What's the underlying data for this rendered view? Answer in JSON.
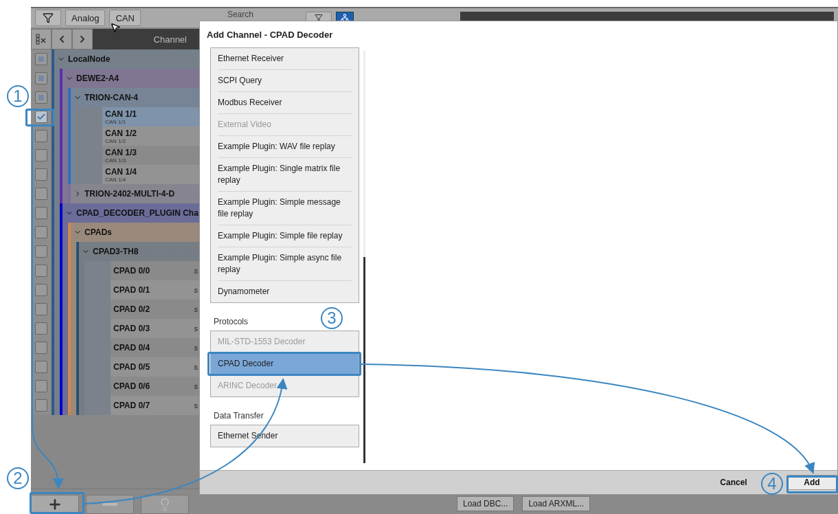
{
  "toolbar": {
    "filters": [
      "Analog",
      "CAN"
    ],
    "search_label": "Search"
  },
  "channel_header": "Channel",
  "tree": [
    {
      "name": "LocalNode",
      "color": "#2d5a8a",
      "expanded": true,
      "checked": false,
      "indeterminate": true,
      "children": [
        {
          "name": "DEWE2-A4",
          "color": "#5a2fb0",
          "expanded": true,
          "checked": false,
          "indeterminate": true,
          "children": [
            {
              "name": "TRION-CAN-4",
              "color": "#2f6fc0",
              "expanded": true,
              "checked": false,
              "indeterminate": true,
              "children": [
                {
                  "name": "CAN 1/1",
                  "sub": "CAN 1/1",
                  "checked": true,
                  "selected": true
                },
                {
                  "name": "CAN 1/2",
                  "sub": "CAN 1/2",
                  "checked": false,
                  "selected": false
                },
                {
                  "name": "CAN 1/3",
                  "sub": "CAN 1/3",
                  "checked": false,
                  "selected": false
                },
                {
                  "name": "CAN 1/4",
                  "sub": "CAN 1/4",
                  "checked": false,
                  "selected": false
                }
              ]
            },
            {
              "name": "TRION-2402-MULTI-4-D",
              "color": "#7a6fa0",
              "expanded": false,
              "checked": false,
              "indeterminate": false
            }
          ]
        },
        {
          "name": "CPAD_DECODER_PLUGIN Cha",
          "color": "#0000d0",
          "expanded": true,
          "checked": false,
          "indeterminate": false,
          "children": [
            {
              "name": "CPADs",
              "color": "#d0884a",
              "expanded": true,
              "checked": false,
              "indeterminate": false,
              "children": [
                {
                  "name": "CPAD3-TH8",
                  "color": "#2d4f70",
                  "expanded": true,
                  "checked": false,
                  "indeterminate": false,
                  "children": [
                    {
                      "name": "CPAD 0/0",
                      "column_2": "s",
                      "checked": false,
                      "selected": false
                    },
                    {
                      "name": "CPAD 0/1",
                      "column_2": "s",
                      "checked": false,
                      "selected": false
                    },
                    {
                      "name": "CPAD 0/2",
                      "column_2": "s",
                      "checked": false,
                      "selected": false
                    },
                    {
                      "name": "CPAD 0/3",
                      "column_2": "s",
                      "checked": false,
                      "selected": false
                    },
                    {
                      "name": "CPAD 0/4",
                      "column_2": "s",
                      "checked": false,
                      "selected": false
                    },
                    {
                      "name": "CPAD 0/5",
                      "column_2": "s",
                      "checked": false,
                      "selected": false
                    },
                    {
                      "name": "CPAD 0/6",
                      "column_2": "s",
                      "checked": false,
                      "selected": false
                    },
                    {
                      "name": "CPAD 0/7",
                      "column_2": "s",
                      "checked": false,
                      "selected": false
                    }
                  ]
                }
              ]
            }
          ]
        }
      ]
    }
  ],
  "bottom_buttons": [
    {
      "kind": "add",
      "disabled": false
    },
    {
      "kind": "remove",
      "disabled": true
    },
    {
      "kind": "wizard",
      "disabled": true
    }
  ],
  "load_buttons": [
    "Load DBC...",
    "Load ARXML..."
  ],
  "dialog": {
    "title": "Add Channel - CPAD Decoder",
    "sections": [
      {
        "items": [
          {
            "label": "Ethernet Receiver",
            "disabled": false,
            "selected": false
          },
          {
            "label": "SCPI Query",
            "disabled": false,
            "selected": false
          },
          {
            "label": "Modbus Receiver",
            "disabled": false,
            "selected": false
          },
          {
            "label": "External Video",
            "disabled": true,
            "selected": false
          },
          {
            "label": "Example Plugin: WAV file replay",
            "disabled": false,
            "selected": false
          },
          {
            "label": "Example Plugin: Single matrix file replay",
            "disabled": false,
            "selected": false
          },
          {
            "label": "Example Plugin: Simple message file replay",
            "disabled": false,
            "selected": false
          },
          {
            "label": "Example Plugin: Simple file replay",
            "disabled": false,
            "selected": false
          },
          {
            "label": "Example Plugin: Simple async file replay",
            "disabled": false,
            "selected": false
          },
          {
            "label": "Dynamometer",
            "disabled": false,
            "selected": false
          }
        ]
      },
      {
        "title": "Protocols",
        "items": [
          {
            "label": "MIL-STD-1553 Decoder",
            "disabled": true,
            "selected": false
          },
          {
            "label": "CPAD Decoder",
            "disabled": false,
            "selected": true
          },
          {
            "label": "ARINC Decoder",
            "disabled": true,
            "selected": false
          }
        ]
      },
      {
        "title": "Data Transfer",
        "items": [
          {
            "label": "Ethernet Sender",
            "disabled": false,
            "selected": false
          }
        ]
      }
    ],
    "buttons": [
      {
        "label": "Cancel",
        "kind": "flat"
      },
      {
        "label": "Add",
        "kind": "default"
      }
    ]
  },
  "steps": [
    "1",
    "2",
    "3",
    "4"
  ]
}
